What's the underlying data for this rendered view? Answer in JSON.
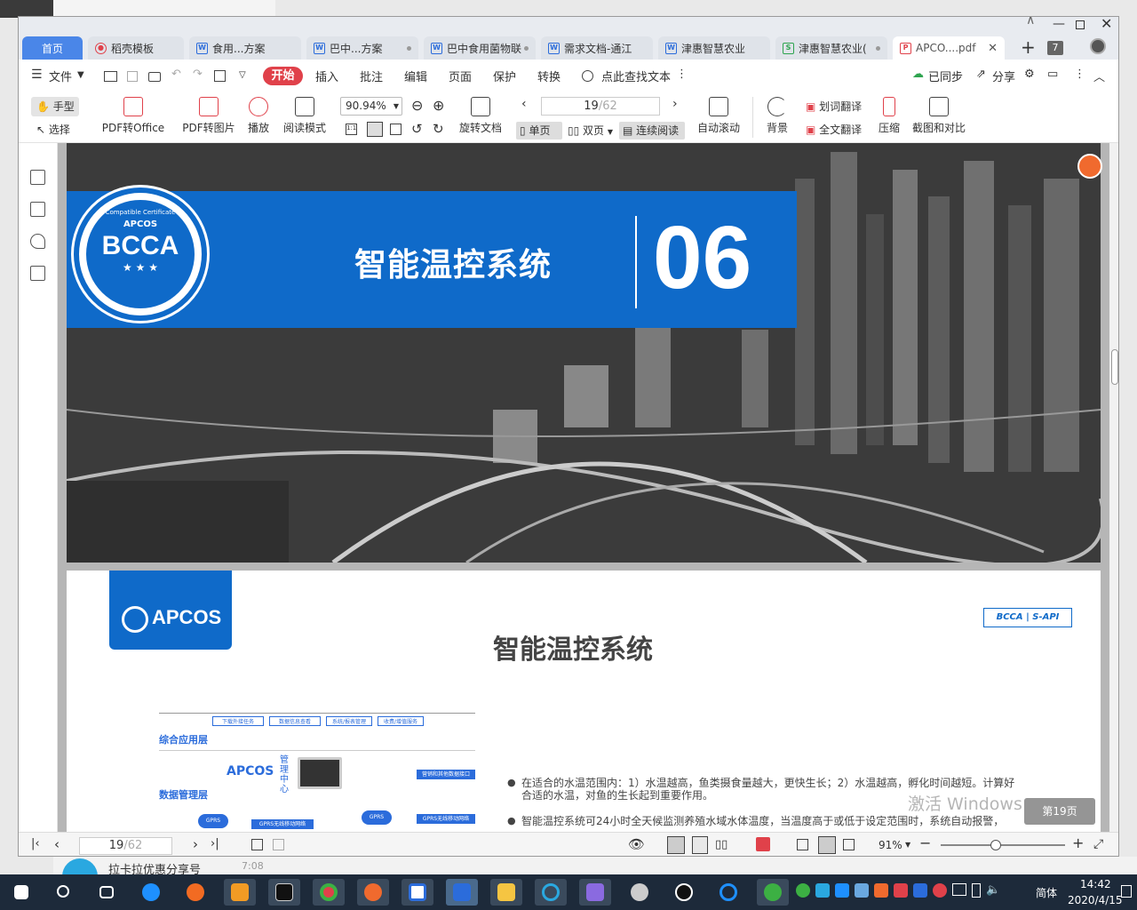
{
  "window": {
    "tabs": [
      {
        "label": "首页"
      },
      {
        "label": "稻壳模板"
      },
      {
        "label": "食用...方案"
      },
      {
        "label": "巴中...方案"
      },
      {
        "label": "巴中食用菌物联"
      },
      {
        "label": "需求文档-通江"
      },
      {
        "label": "津惠智慧农业"
      },
      {
        "label": "津惠智慧农业("
      },
      {
        "label": "APCO....pdf"
      }
    ],
    "tab_count_badge": "7"
  },
  "menu": {
    "file": "文件",
    "start": "开始",
    "items": [
      "插入",
      "批注",
      "编辑",
      "页面",
      "保护",
      "转换"
    ],
    "search": "点此查找文本",
    "sync": "已同步",
    "share": "分享"
  },
  "toolbar": {
    "hand": "手型",
    "select": "选择",
    "pdf_office": "PDF转Office",
    "pdf_image": "PDF转图片",
    "play": "播放",
    "read_mode": "阅读模式",
    "zoom": "90.94%",
    "rotate": "旋转文档",
    "page_current": "19",
    "page_total": "/62",
    "single": "单页",
    "double": "双页",
    "continuous": "连续阅读",
    "auto_scroll": "自动滚动",
    "background": "背景",
    "word_translate": "划词翻译",
    "full_translate": "全文翻译",
    "compress": "压缩",
    "screenshot_compare": "截图和对比"
  },
  "page1": {
    "title": "智能温控系统",
    "number": "06",
    "seal_text": "BCCA",
    "seal_ring": "Compatible Certificate",
    "seal_brand": "APCOS"
  },
  "page2": {
    "logo": "APCOS",
    "title": "智能温控系统",
    "cert": "BCCA | S-API",
    "diagram": {
      "layer1": "综合应用层",
      "layer2": "数据管理层",
      "center": "管理中心",
      "brand": "APCOS",
      "cells": [
        "下载外接任务",
        "数据信息查看",
        "系统/报表管理",
        "收费/增值服务",
        "营销和其他数据接口",
        "GPRS无线移动网络",
        "GPRS无线移动网络"
      ],
      "gprs": "GPRS"
    },
    "bullets": [
      "在适合的水温范围内：1）水温越高，鱼类摄食量越大，更快生长；2）水温越高，孵化时间越短。计算好合适的水温，对鱼的生长起到重要作用。",
      "智能温控系统可24小时全天候监测养殖水域水体温度，当温度高于或低于设定范围时，系统自动报警，"
    ],
    "page_badge": "第19页"
  },
  "status": {
    "page_current": "19",
    "page_total": "/62",
    "zoom": "91%"
  },
  "overlay": {
    "activate": "激活 Windows",
    "notify_title": "拉卡拉优惠分享号",
    "notify_time": "7:08"
  },
  "taskbar": {
    "ime": "简体",
    "time": "14:42",
    "date": "2020/4/15"
  }
}
